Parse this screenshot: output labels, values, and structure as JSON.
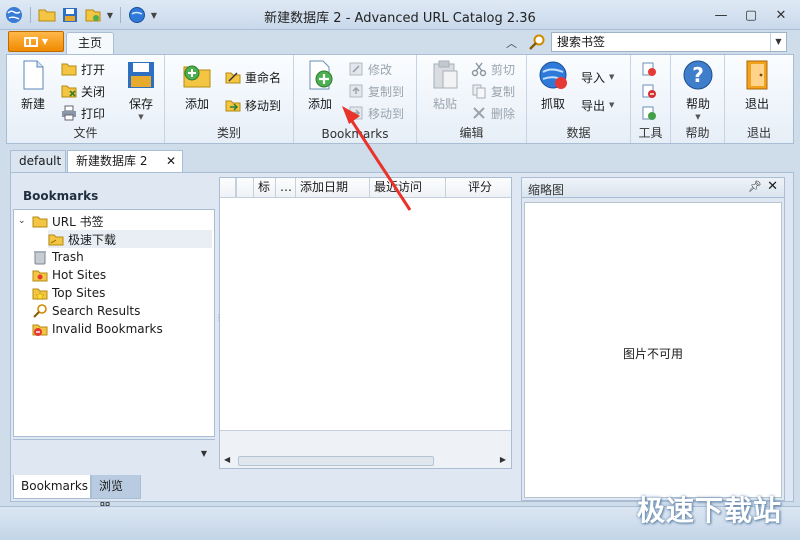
{
  "window": {
    "title": "新建数据库 2 - Advanced URL Catalog 2.36",
    "controls": [
      "minimize",
      "maximize",
      "close"
    ]
  },
  "qat": {
    "icons": [
      "app-globe-icon",
      "open-folder-icon",
      "save-icon",
      "undo-icon",
      "globe-refresh-icon"
    ]
  },
  "tabs": {
    "home_label": "主页"
  },
  "search": {
    "value": "搜索书签"
  },
  "ribbon": {
    "file": {
      "label": "文件",
      "new": "新建",
      "open": "打开",
      "close": "关闭",
      "print": "打印",
      "save": "保存"
    },
    "category": {
      "label": "类别",
      "add": "添加",
      "rename": "重命名",
      "move_to": "移动到"
    },
    "bookmarks": {
      "label": "Bookmarks",
      "add": "添加",
      "modify": "修改",
      "copy_to": "复制到",
      "move_to": "移动到"
    },
    "edit": {
      "label": "编辑",
      "paste": "粘贴",
      "cut": "剪切",
      "copy": "复制",
      "delete": "删除"
    },
    "data": {
      "label": "数据",
      "capture": "抓取",
      "import": "导入",
      "export": "导出"
    },
    "tools": {
      "label": "工具"
    },
    "help": {
      "label": "帮助",
      "help": "帮助"
    },
    "exit": {
      "label": "退出",
      "exit": "退出"
    }
  },
  "doc_tabs": [
    "default",
    "新建数据库 2"
  ],
  "bookmarks_pane": {
    "title": "Bookmarks",
    "tree": [
      {
        "label": "URL 书签",
        "icon": "folder-icon",
        "level": 0,
        "expanded": true
      },
      {
        "label": "极速下载",
        "icon": "folder-icon",
        "level": 1,
        "selected": true
      },
      {
        "label": "Trash",
        "icon": "trash-icon",
        "level": 0
      },
      {
        "label": "Hot Sites",
        "icon": "hot-sites-icon",
        "level": 0
      },
      {
        "label": "Top Sites",
        "icon": "top-sites-icon",
        "level": 0
      },
      {
        "label": "Search Results",
        "icon": "search-results-icon",
        "level": 0
      },
      {
        "label": "Invalid Bookmarks",
        "icon": "invalid-bookmarks-icon",
        "level": 0
      }
    ]
  },
  "list": {
    "columns": [
      "",
      "标",
      "…",
      "添加日期",
      "最近访问",
      "评分"
    ]
  },
  "thumbnail": {
    "title": "缩略图",
    "message": "图片不可用"
  },
  "bottom_tabs": [
    "Bookmarks",
    "浏览器"
  ],
  "watermark": "极速下载站",
  "colors": {
    "accent_orange": "#f08a00",
    "annotation_arrow": "#e8332a",
    "ribbon_bg": "#e6eef7"
  }
}
